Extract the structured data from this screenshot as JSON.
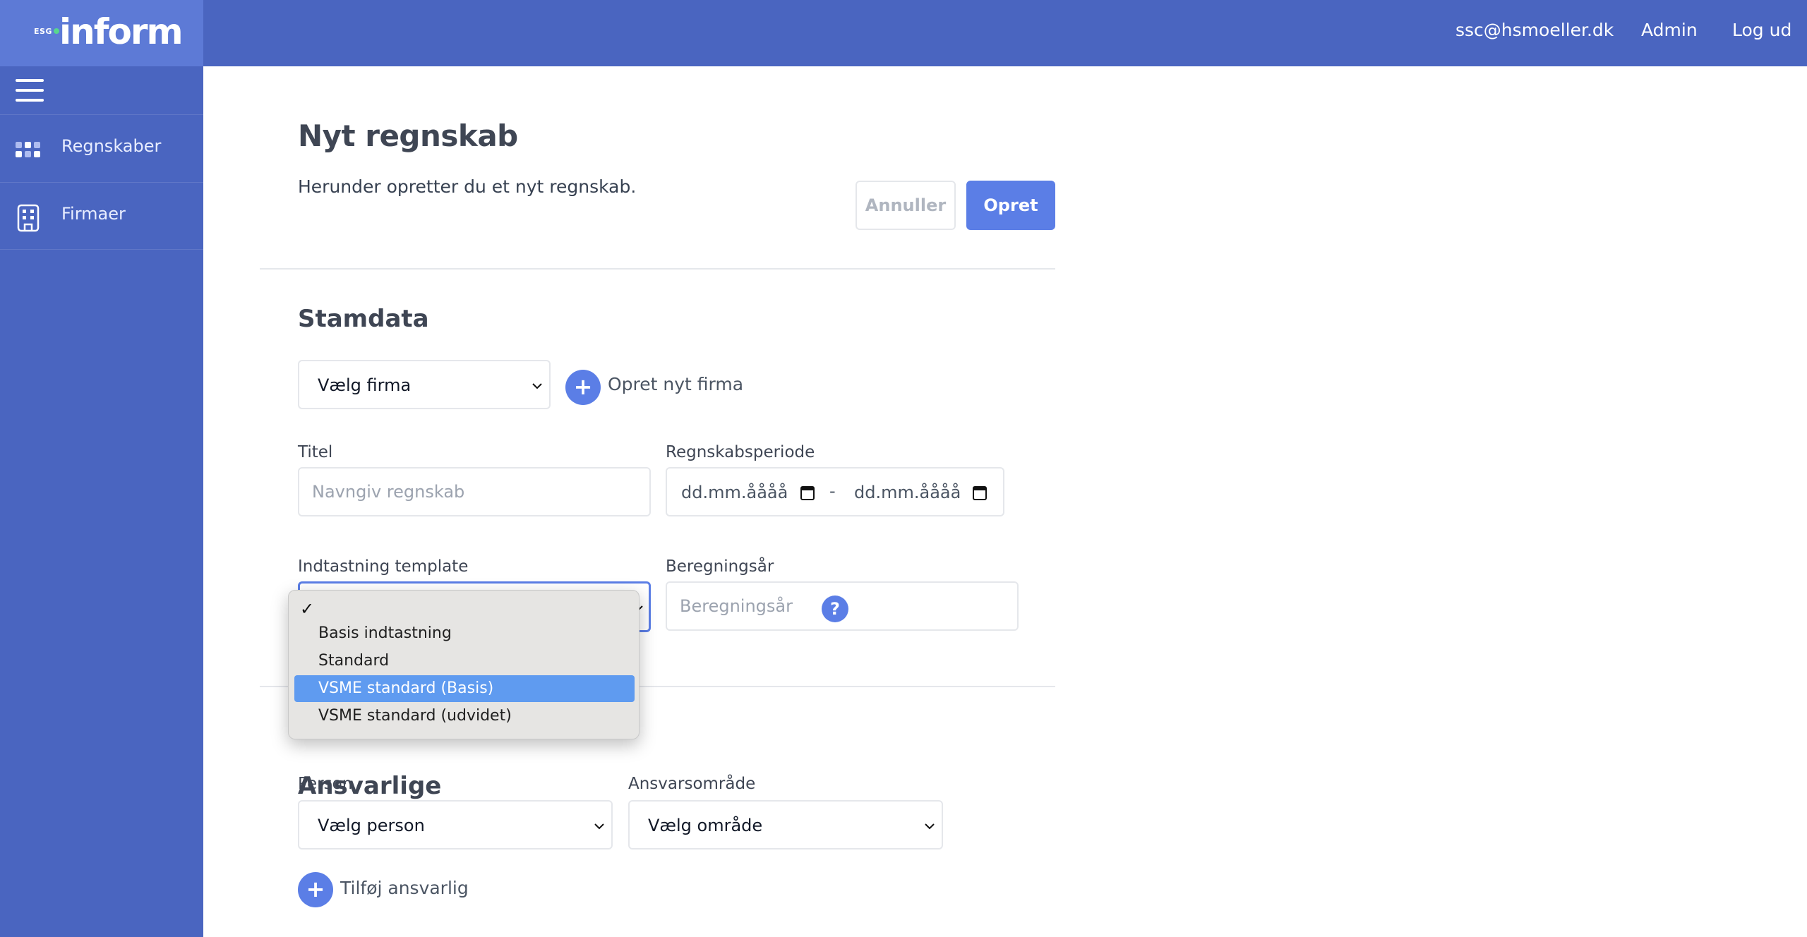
{
  "header": {
    "logo_prefix": "ESG",
    "logo_text": "inform",
    "user_email": "ssc@hsmoeller.dk",
    "admin_label": "Admin",
    "logout_label": "Log ud"
  },
  "sidebar": {
    "items": [
      {
        "label": "Regnskaber",
        "icon": "grid-icon"
      },
      {
        "label": "Firmaer",
        "icon": "building-icon"
      }
    ]
  },
  "page": {
    "title": "Nyt regnskab",
    "subtitle": "Herunder opretter du et nyt regnskab.",
    "cancel_label": "Annuller",
    "create_label": "Opret"
  },
  "stamdata": {
    "section_title": "Stamdata",
    "company_select": "Vælg firma",
    "new_company_label": "Opret nyt firma",
    "title_label": "Titel",
    "title_placeholder": "Navngiv regnskab",
    "period_label": "Regnskabsperiode",
    "period_from": "dd.mm.åååå",
    "period_separator": "-",
    "period_to": "dd.mm.åååå",
    "template_label": "Indtastning template",
    "calc_year_label": "Beregningsår",
    "calc_year_placeholder": "Beregningsår",
    "help_symbol": "?"
  },
  "template_dropdown": {
    "selected_mark": "✓",
    "options": [
      "Basis indtastning",
      "Standard",
      "VSME standard (Basis)",
      "VSME standard (udvidet)"
    ],
    "highlighted_index": 2
  },
  "ansvarlige": {
    "section_title": "Ansvarlige",
    "person_label": "Person",
    "person_select": "Vælg person",
    "area_label": "Ansvarsområde",
    "area_select": "Vælg område",
    "add_label": "Tilføj ansvarlig"
  },
  "colors": {
    "header_bg": "#4a65c0",
    "logo_bg": "#5d7ad6",
    "accent": "#5b7ee6",
    "dropdown_highlight": "#5f9bf0"
  }
}
